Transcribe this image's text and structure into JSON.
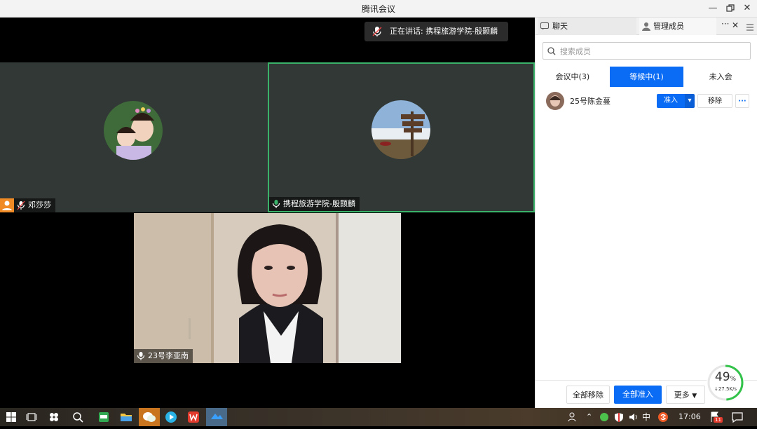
{
  "window": {
    "title": "腾讯会议"
  },
  "speaking_banner": {
    "text": "正在讲话: 携程旅游学院-殷颢麟"
  },
  "tiles": [
    {
      "name": "邓莎莎",
      "host": true,
      "muted": true
    },
    {
      "name": "携程旅游学院-殷颢麟",
      "host": false,
      "muted": false,
      "active": true
    },
    {
      "name": "23号李亚南",
      "host": false,
      "muted": false
    }
  ],
  "panel": {
    "tabs": [
      {
        "label": "聊天",
        "icon": "chat-icon"
      },
      {
        "label": "管理成员",
        "icon": "person-icon"
      }
    ],
    "search_placeholder": "搜索成员",
    "segments": [
      "会议中(3)",
      "等候中(1)",
      "未入会"
    ],
    "active_segment": 1,
    "waiting_members": [
      {
        "name": "25号陈金蔓",
        "admit_label": "准入",
        "remove_label": "移除",
        "more_label": "···"
      }
    ],
    "footer": {
      "remove_all": "全部移除",
      "admit_all": "全部准入",
      "more": "更多"
    }
  },
  "network": {
    "percent": "49",
    "percent_unit": "%",
    "speed": "↓27.5K/s",
    "fraction": 0.49
  },
  "taskbar": {
    "ime": "中",
    "clock": "17:06",
    "notification_count": "11"
  },
  "colors": {
    "accent": "#0a6cf4",
    "active_border": "#3ab26a",
    "host_badge": "#f08a24"
  }
}
